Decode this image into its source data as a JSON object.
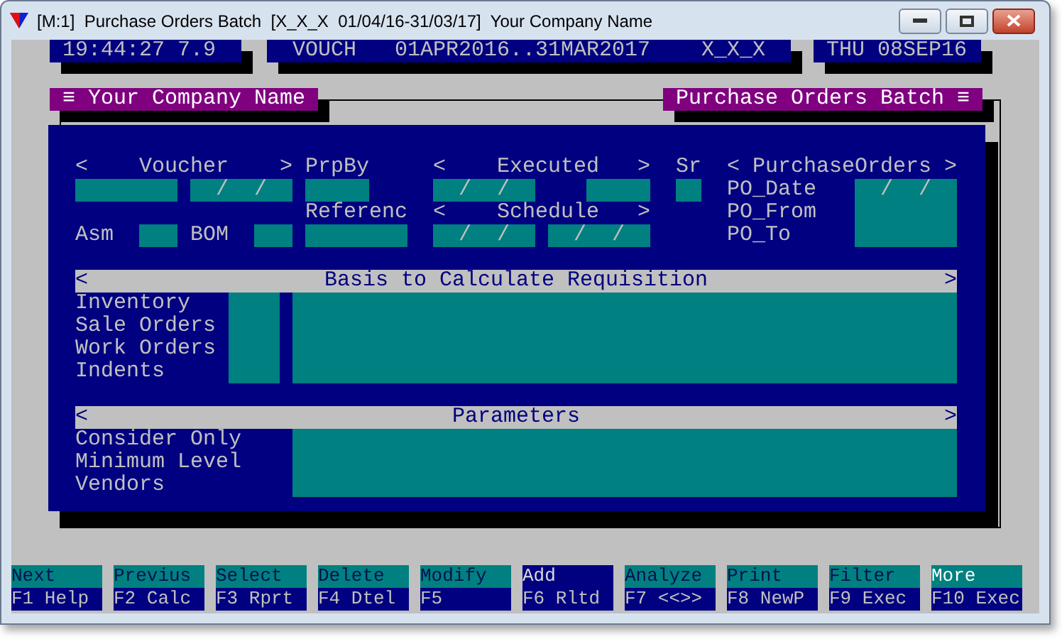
{
  "window": {
    "title": "[M:1]  Purchase Orders Batch  [X_X_X  01/04/16-31/03/17]  Your Company Name"
  },
  "status_bar": {
    "time": "19:44:27 7.9",
    "module": "VOUCH",
    "period": "01APR2016..31MAR2017",
    "code": "X_X_X",
    "date": "THU 08SEP16"
  },
  "headers": {
    "left": "≡ Your Company Name",
    "right": "Purchase Orders Batch ≡"
  },
  "form": {
    "voucher_header": {
      "open": "<",
      "label": "Voucher",
      "close": ">"
    },
    "prpby_label": "PrpBy",
    "executed_header": {
      "open": "<",
      "label": "Executed",
      "close": ">"
    },
    "sr_label": "Sr",
    "purchase_orders_header": {
      "open": "<",
      "label": "PurchaseOrders",
      "close": ">"
    },
    "voucher_date": {
      "value": "/  /"
    },
    "executed_date": {
      "value": "/  /"
    },
    "referenc_label": "Referenc",
    "schedule_header": {
      "open": "<",
      "label": "Schedule",
      "close": ">"
    },
    "asm_label": "Asm",
    "bom_label": "BOM",
    "schedule_from": {
      "value": "/  /"
    },
    "schedule_to": {
      "value": "/  /"
    },
    "po_labels": [
      "PO_Date",
      "PO_From",
      "PO_To"
    ],
    "po_date": {
      "value": "/  /"
    }
  },
  "basis": {
    "open": "<",
    "title": "Basis to Calculate Requisition",
    "close": ">",
    "items": [
      "Inventory",
      "Sale Orders",
      "Work Orders",
      "Indents"
    ]
  },
  "parameters": {
    "open": "<",
    "title": "Parameters",
    "close": ">",
    "items": [
      "Consider Only",
      "Minimum Level",
      "Vendors"
    ]
  },
  "function_keys": [
    {
      "action": "Next",
      "key": "F1 Help",
      "selected": false,
      "highlight": false
    },
    {
      "action": "Previus",
      "key": "F2 Calc",
      "selected": false,
      "highlight": false
    },
    {
      "action": "Select",
      "key": "F3 Rprt",
      "selected": false,
      "highlight": false
    },
    {
      "action": "Delete",
      "key": "F4 Dtel",
      "selected": false,
      "highlight": false
    },
    {
      "action": "Modify",
      "key": "F5",
      "selected": false,
      "highlight": false
    },
    {
      "action": "Add",
      "key": "F6 Rltd",
      "selected": true,
      "highlight": false
    },
    {
      "action": "Analyze",
      "key": "F7 <<>>",
      "selected": false,
      "highlight": false
    },
    {
      "action": "Print",
      "key": "F8 NewP",
      "selected": false,
      "highlight": false
    },
    {
      "action": "Filter",
      "key": "F9 Exec",
      "selected": false,
      "highlight": false
    },
    {
      "action": "More",
      "key": "F10 Exec",
      "selected": false,
      "highlight": true
    }
  ]
}
